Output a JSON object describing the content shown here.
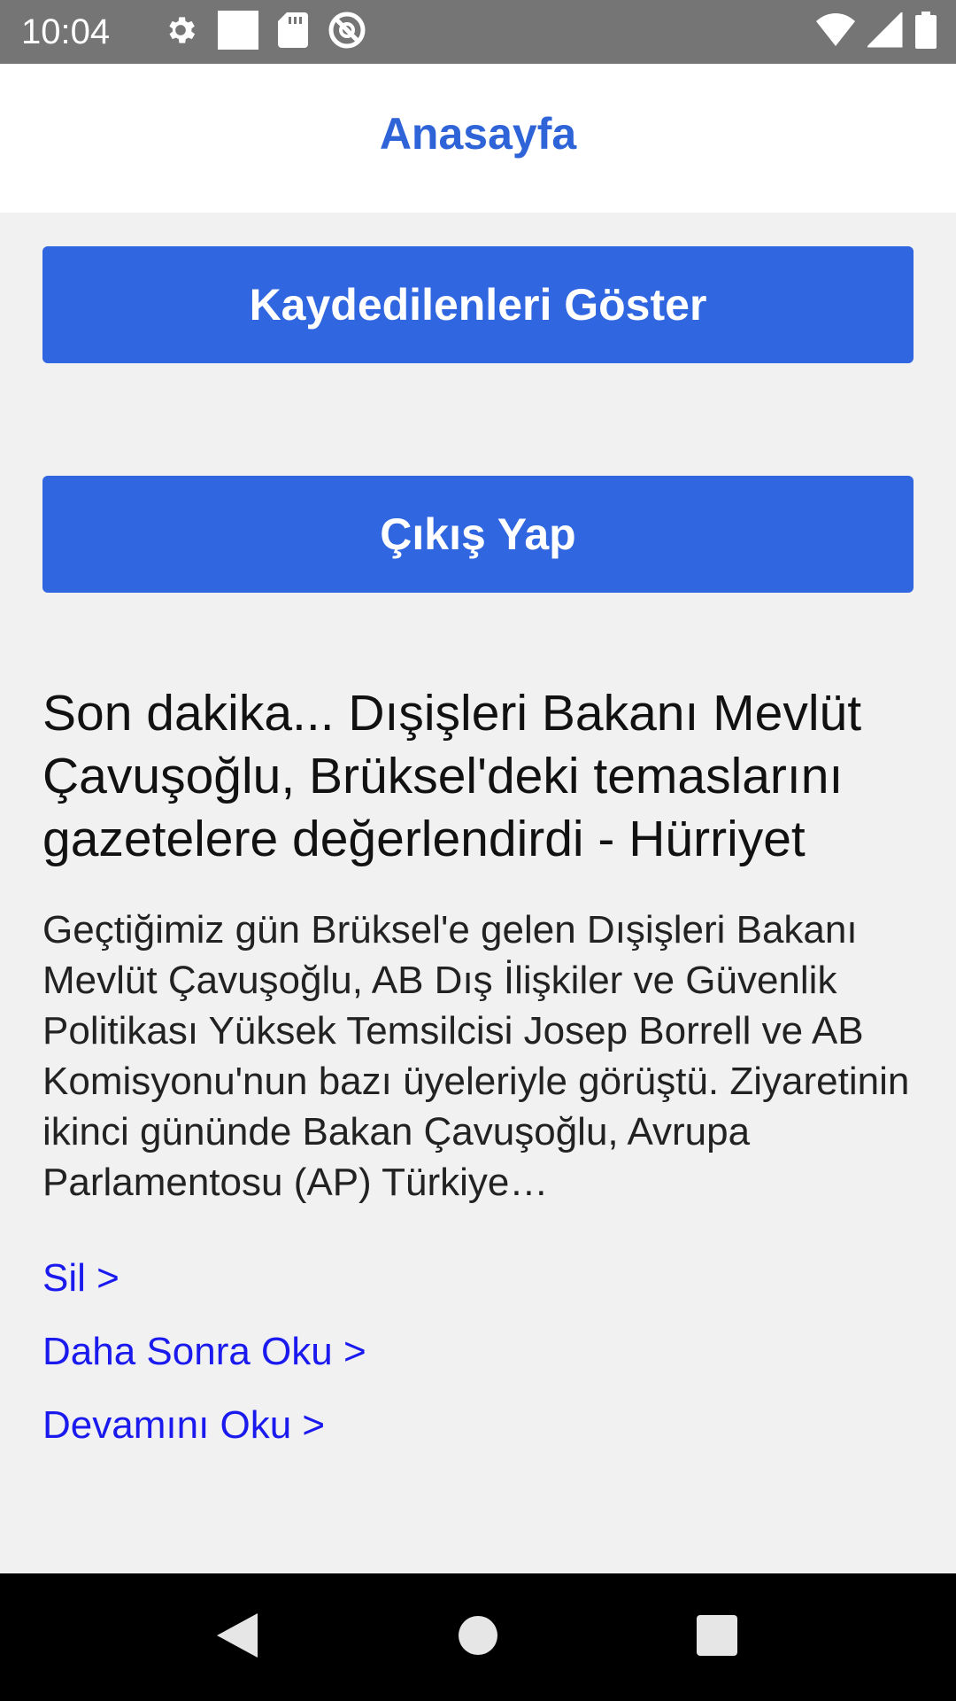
{
  "status_bar": {
    "time": "10:04",
    "left_icons": [
      "gear-icon",
      "square-notification-icon",
      "sd-card-icon",
      "do-not-disturb-icon"
    ],
    "right_icons": [
      "wifi-icon",
      "signal-icon",
      "battery-icon"
    ]
  },
  "app_bar": {
    "title": "Anasayfa"
  },
  "buttons": {
    "show_saved": "Kaydedilenleri Göster",
    "logout": "Çıkış Yap"
  },
  "article": {
    "title": "Son dakika... Dışişleri Bakanı Mevlüt Çavuşoğlu, Brüksel'deki temaslarını gazetelere değerlendirdi - Hürriyet",
    "summary": "Geçtiğimiz gün Brüksel'e gelen Dışişleri Bakanı Mevlüt Çavuşoğlu, AB Dış İlişkiler ve Güvenlik Politikası Yüksek Temsilcisi Josep Borrell ve AB Komisyonu'nun bazı üyeleriyle görüştü. Ziyaretinin ikinci gününde Bakan Çavuşoğlu, Avrupa Parlamentosu (AP) Türkiye…",
    "links": {
      "delete": "Sil >",
      "read_later": "Daha Sonra Oku >",
      "read_more": "Devamını Oku >"
    }
  },
  "nav_bar": {
    "icons": [
      "back-icon",
      "home-icon",
      "recents-icon"
    ]
  },
  "colors": {
    "primary": "#3066e0",
    "title": "#2f63d8",
    "link": "#1a1aee",
    "status_bar": "#757575",
    "background": "#f1f1f1"
  }
}
